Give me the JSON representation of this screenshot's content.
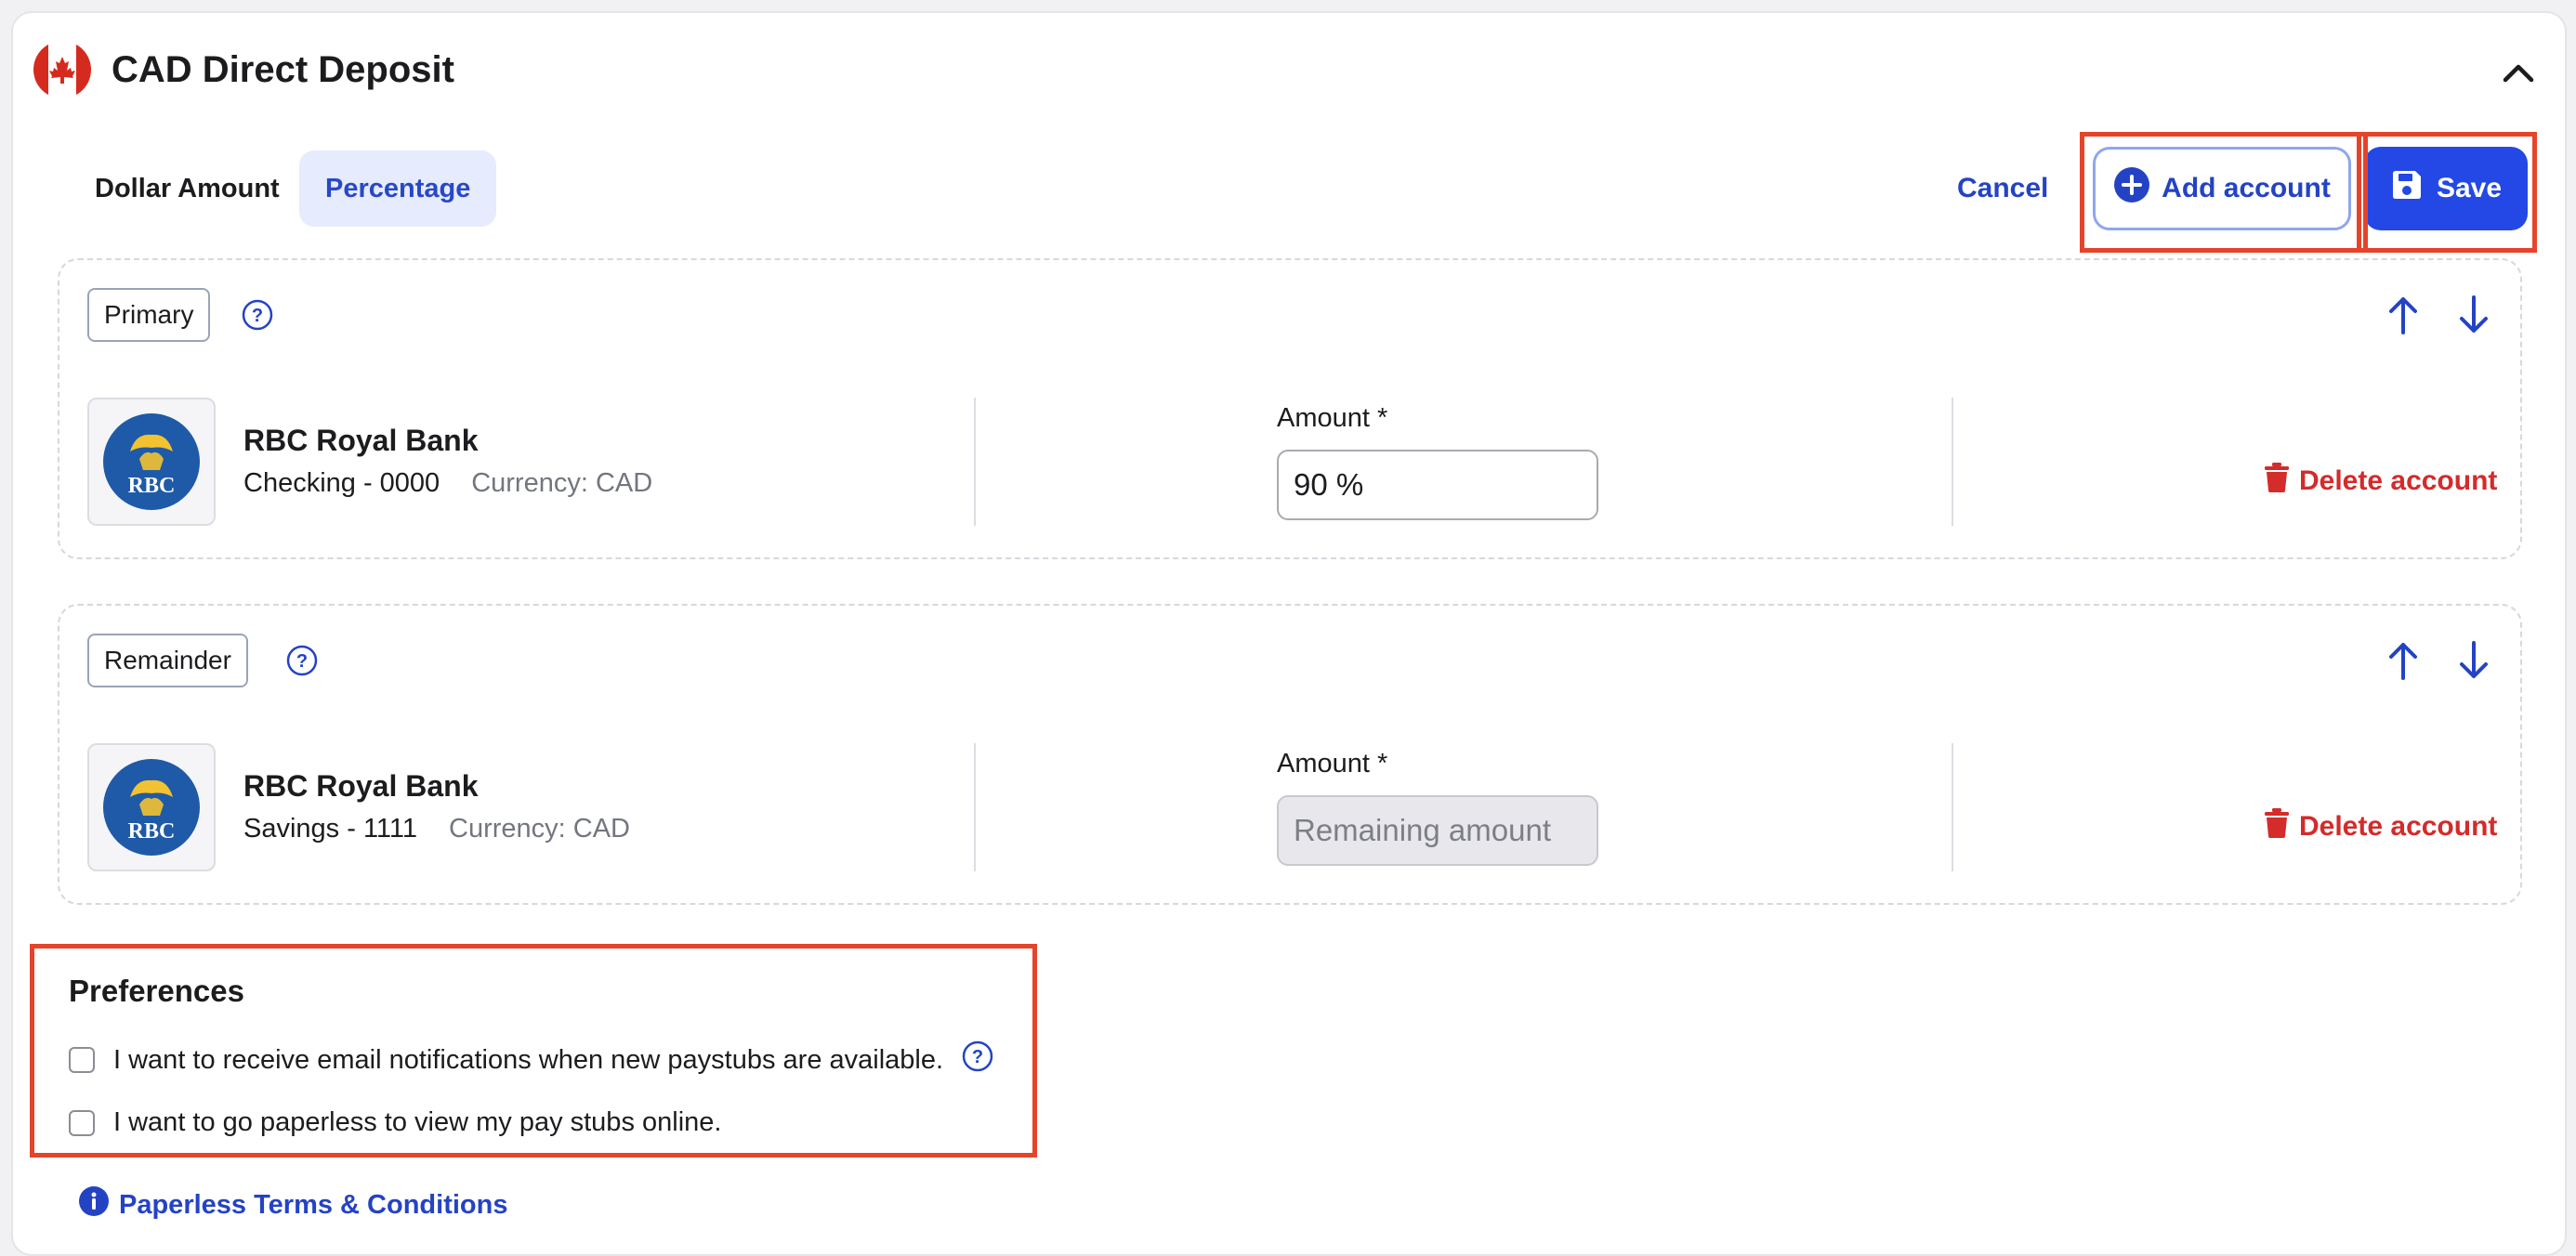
{
  "header": {
    "title": "CAD Direct Deposit",
    "flag_icon": "canada-flag-icon",
    "collapse_icon": "chevron-up-icon"
  },
  "tabs": [
    {
      "label": "Dollar Amount",
      "active": false
    },
    {
      "label": "Percentage",
      "active": true
    }
  ],
  "toolbar": {
    "cancel_label": "Cancel",
    "add_account_label": "Add account",
    "save_label": "Save"
  },
  "accounts": [
    {
      "role": "Primary",
      "bank": "RBC Royal Bank",
      "account": "Checking - 0000",
      "currency": "Currency: CAD",
      "amount_label": "Amount *",
      "amount_value": "90 %",
      "amount_placeholder": "",
      "delete_label": "Delete account"
    },
    {
      "role": "Remainder",
      "bank": "RBC Royal Bank",
      "account": "Savings - 1111",
      "currency": "Currency: CAD",
      "amount_label": "Amount *",
      "amount_value": "",
      "amount_placeholder": "Remaining amount",
      "delete_label": "Delete account"
    }
  ],
  "preferences": {
    "title": "Preferences",
    "email_notifications_label": "I want to receive email notifications when new paystubs are available.",
    "paperless_label": "I want to go paperless to view my pay stubs online.",
    "email_checked": false,
    "paperless_checked": false
  },
  "terms_link": "Paperless Terms & Conditions",
  "bank_logo_text": "RBC",
  "colors": {
    "accent": "#2348e6",
    "link": "#2443c4",
    "danger": "#d42b2b",
    "highlight": "#e5442a",
    "tab_active_bg": "#e6ebfd"
  }
}
